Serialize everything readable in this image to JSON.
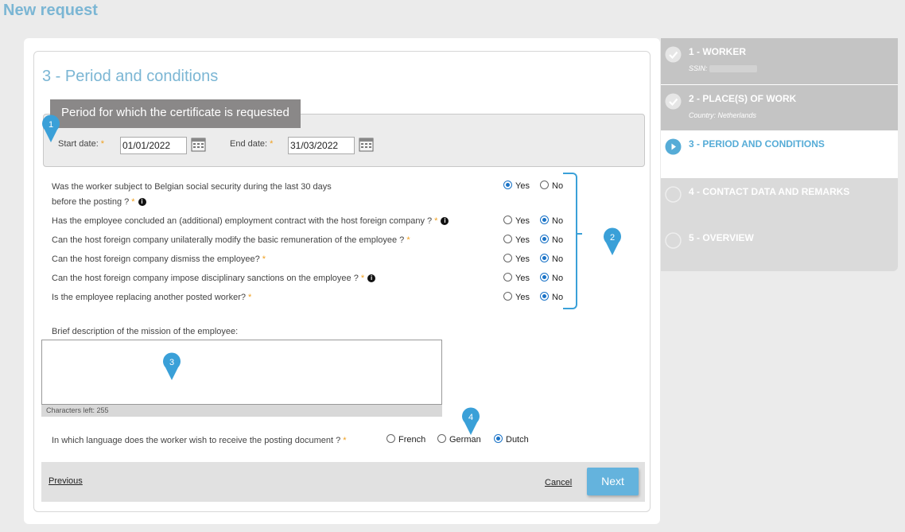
{
  "page": {
    "title": "New request"
  },
  "form": {
    "section_title": "3 - Period and conditions",
    "period": {
      "header": "Period for which the certificate is requested",
      "start_label": "Start date:",
      "start_value": "01/01/2022",
      "end_label": "End date:",
      "end_value": "31/03/2022",
      "required_mark": "*"
    },
    "questions": [
      {
        "text_line1": "Was the worker subject to Belgian social security during the last 30 days",
        "text_line2": "before the posting ?",
        "answer": "Yes"
      },
      {
        "text": "Has the employee concluded an (additional) employment contract with the host foreign company ?",
        "answer": "No"
      },
      {
        "text": "Can the host foreign company unilaterally modify the basic remuneration of the employee ?",
        "answer": "No"
      },
      {
        "text": "Can the host foreign company dismiss the employee?",
        "answer": "No"
      },
      {
        "text": "Can the host foreign company impose disciplinary sanctions on the employee ?",
        "answer": "No"
      },
      {
        "text": "Is the employee replacing another posted worker?",
        "answer": "No"
      }
    ],
    "yes_label": "Yes",
    "no_label": "No",
    "description": {
      "label": "Brief description of the mission of the employee:",
      "value": "",
      "chars_left": "Characters left: 255"
    },
    "language": {
      "question": "In which language does the worker wish to receive the posting document ?",
      "options": [
        "French",
        "German",
        "Dutch"
      ],
      "selected": "Dutch"
    },
    "footer": {
      "previous_label": "Previous",
      "cancel_label": "Cancel",
      "next_label": "Next"
    },
    "markers": [
      "1",
      "2",
      "3",
      "4"
    ]
  },
  "sidebar": {
    "steps": [
      {
        "title": "1 - WORKER",
        "sub": "SSIN:",
        "state": "done"
      },
      {
        "title": "2 - PLACE(S) OF WORK",
        "sub": "Country: Netherlands",
        "state": "done"
      },
      {
        "title": "3 - PERIOD AND CONDITIONS",
        "sub": "",
        "state": "active"
      },
      {
        "title": "4 - CONTACT DATA AND REMARKS",
        "sub": "",
        "state": "todo"
      },
      {
        "title": "5 - OVERVIEW",
        "sub": "",
        "state": "todo"
      }
    ]
  },
  "colors": {
    "accent": "#64b3dd",
    "title": "#7bb6d4",
    "marker": "#3aa0d8",
    "required": "#f0a020"
  },
  "icons": [
    "calendar-icon",
    "info-icon",
    "check-icon",
    "play-icon",
    "marker-pin-icon"
  ]
}
